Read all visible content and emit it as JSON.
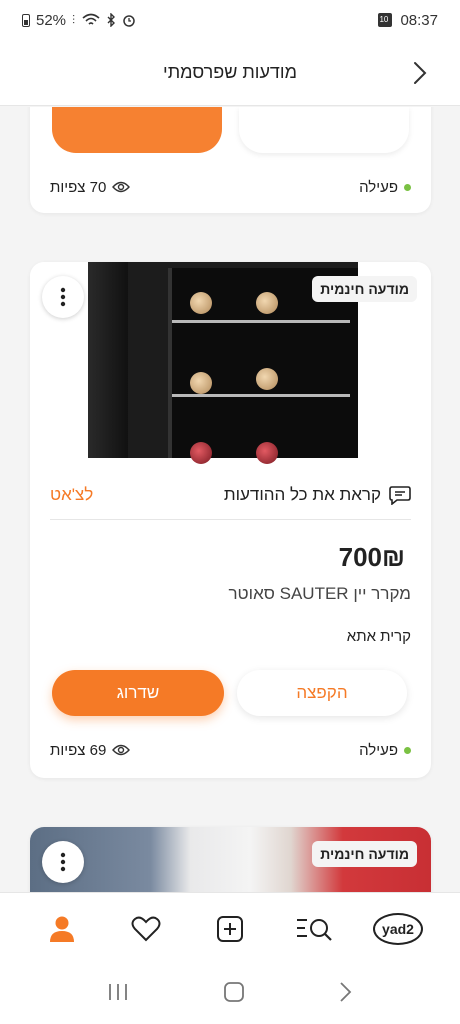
{
  "status_bar": {
    "battery": "52%",
    "time": "08:37"
  },
  "header": {
    "title": "מודעות שפרסמתי"
  },
  "top_card": {
    "status": "פעילה",
    "views": "70 צפיות"
  },
  "main_card": {
    "badge": "מודעה חינמית",
    "read_all": "קראת את כל ההודעות",
    "chat_link": "לצ'אט",
    "price": "700₪",
    "title": "מקרר יין SAUTER סאוטר",
    "city": "קרית אתא",
    "upgrade_button": "שדרוג",
    "bump_button": "הקפצה",
    "status": "פעילה",
    "views": "69 צפיות"
  },
  "bottom_card": {
    "badge": "מודעה חינמית"
  },
  "bottom_nav": {
    "logo": "yad2"
  },
  "colors": {
    "accent": "#f57a26",
    "active_dot": "#7ac143"
  }
}
